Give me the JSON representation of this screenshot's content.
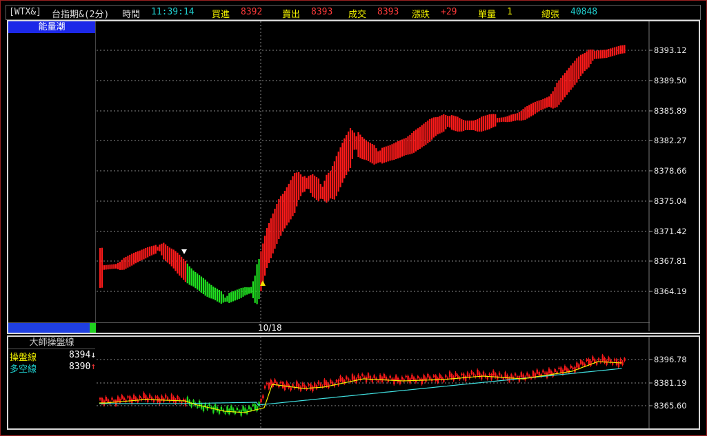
{
  "header": {
    "symbol": "[WTX&]",
    "name": "台指期&(2分)",
    "time_label": "時間",
    "time": "11:39:14",
    "bid_label": "買進",
    "bid": "8392",
    "ask_label": "賣出",
    "ask": "8393",
    "trade_label": "成交",
    "trade": "8393",
    "change_label": "漲跌",
    "change": "+29",
    "single_vol_label": "單量",
    "single_vol": "1",
    "total_vol_label": "總張",
    "total_vol": "40848"
  },
  "upper_panel": {
    "title": "能量潮",
    "date_label": "10/18",
    "y_ticks": [
      "8393.12",
      "8389.50",
      "8385.89",
      "8382.27",
      "8378.66",
      "8375.04",
      "8371.42",
      "8367.81",
      "8364.19"
    ]
  },
  "lower_panel": {
    "title": "大師操盤線",
    "line1_label": "操盤線",
    "line1_value": "8394",
    "line1_arrow": "↓",
    "line2_label": "多空線",
    "line2_value": "8390",
    "line2_arrow": "↑",
    "y_ticks": [
      "8396.78",
      "8381.19",
      "8365.60"
    ]
  },
  "colors": {
    "up": "#ff1a1a",
    "down": "#20e020",
    "yellow_line": "#f0f000",
    "cyan_line": "#40e0e0",
    "grid": "#8a8a8a"
  }
}
